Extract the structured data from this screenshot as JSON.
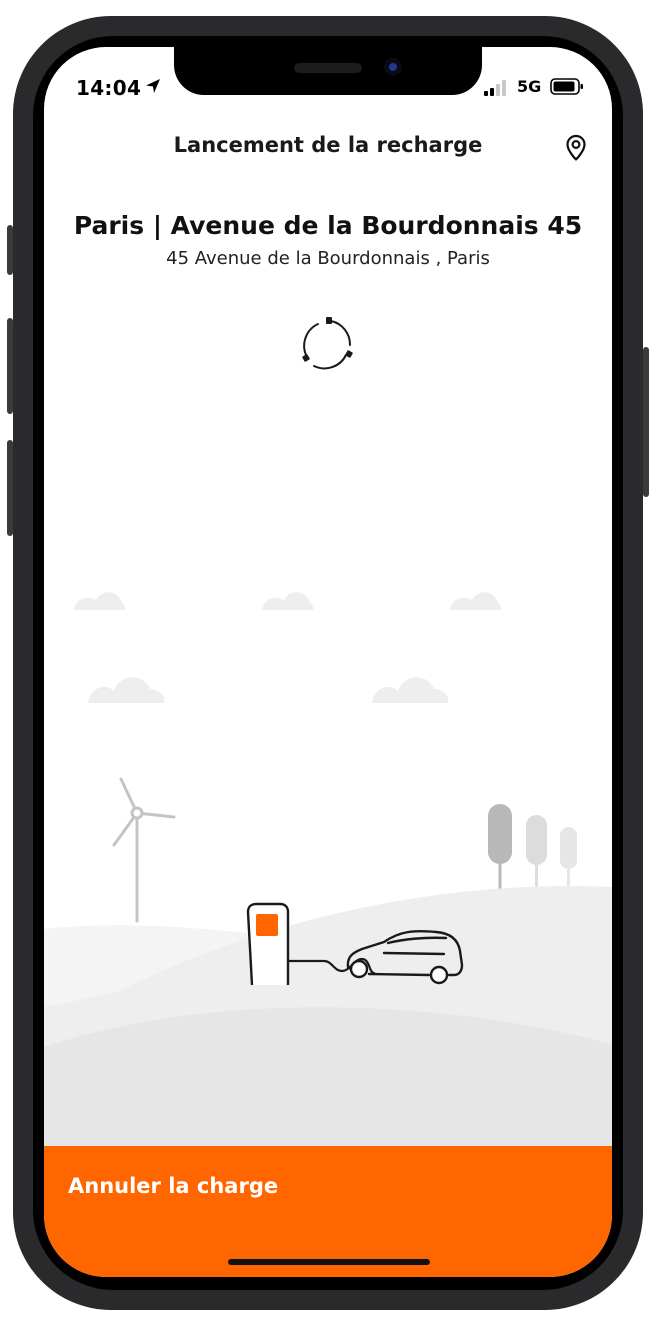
{
  "status_bar": {
    "time": "14:04",
    "network": "5G"
  },
  "header": {
    "title": "Lancement de la recharge",
    "map_icon": "map-pin-icon"
  },
  "station": {
    "name": "Paris | Avenue de la Bourdonnais 45",
    "address": "45 Avenue de la Bourdonnais , Paris"
  },
  "loading_icon": "charging-connector-spinner-icon",
  "actions": {
    "cancel_label": "Annuler la charge"
  },
  "colors": {
    "accent": "#ff6600",
    "text": "#111111",
    "background": "#ffffff"
  }
}
